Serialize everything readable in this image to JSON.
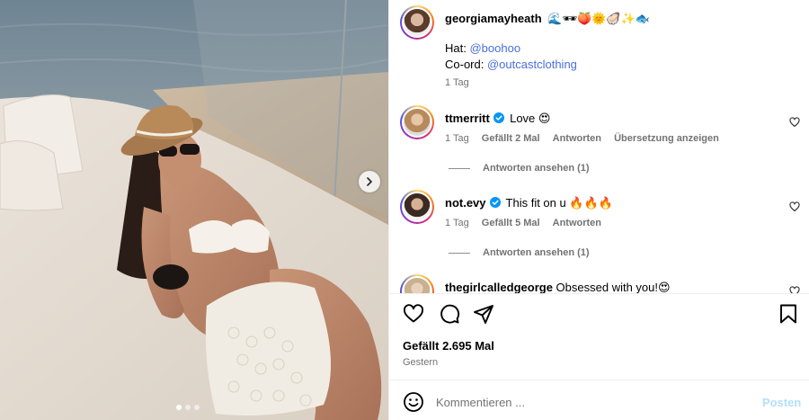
{
  "post": {
    "author": {
      "username": "georgiamayheath",
      "emojis": "🌊🕶🍑🌞🦪✨🐟"
    },
    "caption": {
      "hat_label": "Hat:",
      "hat_mention": "@boohoo",
      "coord_label": "Co-ord:",
      "coord_mention": "@outcastclothing"
    },
    "time": "1 Tag"
  },
  "comments": [
    {
      "username": "ttmerritt",
      "verified": true,
      "text": "Love 😍",
      "time": "1 Tag",
      "likes": "Gefällt 2 Mal",
      "reply": "Antworten",
      "translate": "Übersetzung anzeigen",
      "view_replies": "Antworten ansehen (1)"
    },
    {
      "username": "not.evy",
      "verified": true,
      "text": "This fit on u 🔥🔥🔥",
      "time": "1 Tag",
      "likes": "Gefällt 5 Mal",
      "reply": "Antworten",
      "view_replies": "Antworten ansehen (1)"
    },
    {
      "username": "thegirlcalledgeorge",
      "verified": false,
      "text": "Obsessed with you!😍"
    }
  ],
  "actions": {
    "like_icon": "heart-icon",
    "comment_icon": "comment-icon",
    "share_icon": "paper-plane-icon",
    "save_icon": "bookmark-icon"
  },
  "likes_text": "Gefällt 2.695 Mal",
  "date_text": "Gestern",
  "comment_box": {
    "placeholder": "Kommentieren ...",
    "post_label": "Posten",
    "emoji_icon": "smiley-icon"
  },
  "carousel": {
    "slide_count": 3,
    "active_index": 0
  },
  "colors": {
    "link": "#4a6edb",
    "muted": "#737373",
    "verified": "#0095f6",
    "post_disabled": "#b2dffc"
  }
}
